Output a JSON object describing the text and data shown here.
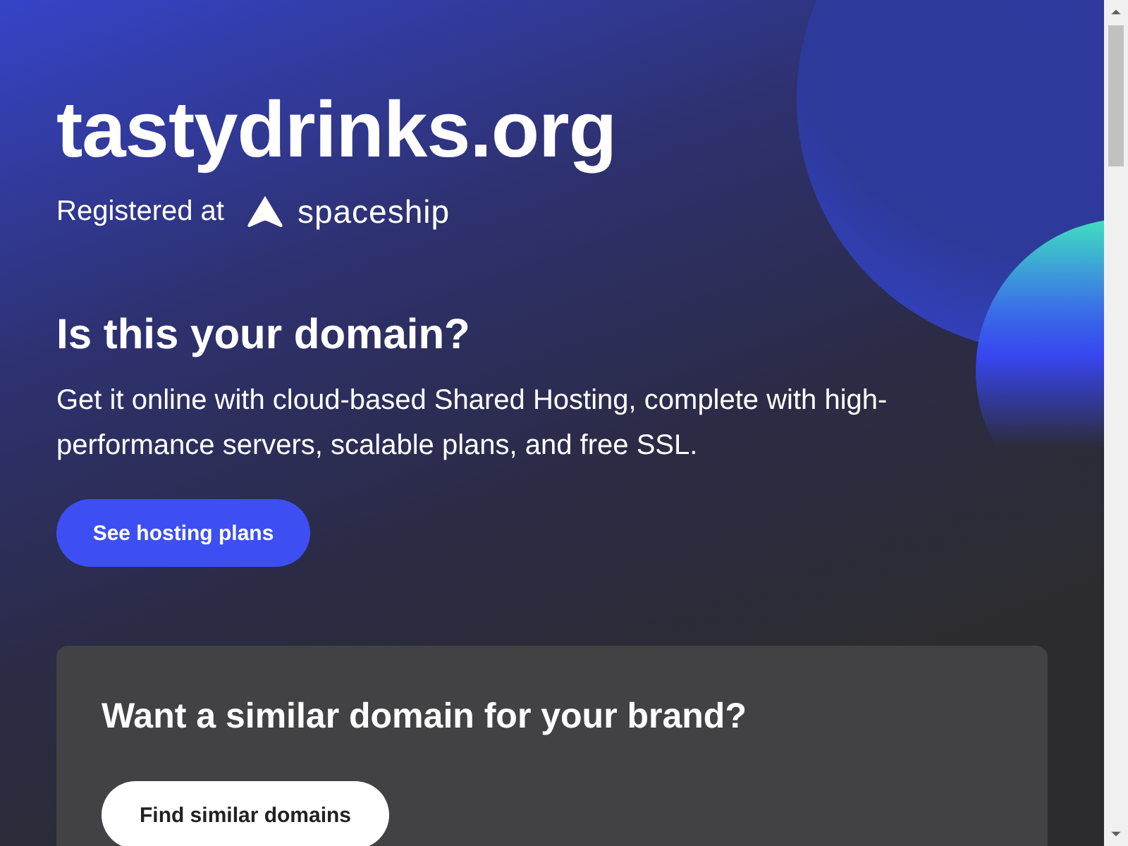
{
  "domain": "tastydrinks.org",
  "registrar": {
    "label": "Registered at",
    "brand": "spaceship"
  },
  "hosting": {
    "heading": "Is this your domain?",
    "text": "Get it online with cloud-based Shared Hosting, complete with high-performance servers, scalable plans, and free SSL.",
    "button": "See hosting plans"
  },
  "similar": {
    "heading": "Want a similar domain for your brand?",
    "button": "Find similar domains"
  }
}
